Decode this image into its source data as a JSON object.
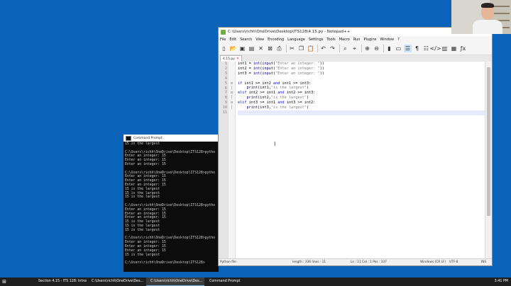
{
  "cmd_window": {
    "title": "Command Prompt",
    "lines": [
      "15 is the largest",
      "",
      "C:\\Users\\richh\\OneDrive\\Desktop\\ITS128>pytho",
      "Enter an integer: 15",
      "Enter an integer: 15",
      "Enter an integer: 15",
      "",
      "C:\\Users\\richh\\OneDrive\\Desktop\\ITS128>pytho",
      "Enter an integer: 15",
      "Enter an integer: 15",
      "Enter an integer: 15",
      "15 is the largest",
      "15 is the largest",
      "15 is the largest",
      "",
      "C:\\Users\\richh\\OneDrive\\Desktop\\ITS128>pytho",
      "Enter an integer: 15",
      "Enter an integer: 15",
      "Enter an integer: 15",
      "15 is the largest",
      "15 is the largest",
      "15 is the largest",
      "",
      "C:\\Users\\richh\\OneDrive\\Desktop\\ITS128>pytho",
      "Enter an integer: 15",
      "Enter an integer: 15",
      "Enter an integer: 15",
      "15 is the largest",
      "",
      "C:\\Users\\richh\\OneDrive\\Desktop\\ITS128>"
    ]
  },
  "notepad": {
    "title": "C:\\Users\\richh\\OneDrive\\Desktop\\ITS128\\4.15.py - Notepad++",
    "menu": [
      "File",
      "Edit",
      "Search",
      "View",
      "Encoding",
      "Language",
      "Settings",
      "Tools",
      "Macro",
      "Run",
      "Plugins",
      "Window",
      "?"
    ],
    "tab_label": "4.15.py",
    "line_numbers": [
      "1",
      "2",
      "3",
      "4",
      "5",
      "6",
      "7",
      "8",
      "9",
      "10",
      "11"
    ],
    "code_lines": [
      "int1 = int(input(\"Enter an integer: \"))",
      "int2 = int(input(\"Enter an integer: \"))",
      "int3 = int(input(\"Enter an integer: \"))",
      "",
      "if int1 >= int2 and int1 >= int3:",
      "    print(int1,\"is the largest\")",
      "elif int2 >= int1 and int2 >= int3:",
      "    print(int2,\"is the largest\")",
      "elif int3 >= int1 and int3 >= int2:",
      "    print(int3,\"is the largest\")",
      ""
    ],
    "status": {
      "file_type": "Python file",
      "length": "length : 336    lines : 11",
      "position": "Ln : 11    Col : 1    Pos : 337",
      "eol": "Windows (CR LF)",
      "encoding": "UTF-8",
      "mode": "INS"
    }
  },
  "taskbar": {
    "tasks": [
      {
        "label": "Section 4.15 - ITS 128: Introd...",
        "color": "#e8592a"
      },
      {
        "label": "C:\\Users\\richh\\OneDrive\\Des...",
        "color": "#f0c419"
      },
      {
        "label": "C:\\Users\\richh\\OneDrive\\Des...",
        "color": "#6cb33e"
      },
      {
        "label": "Command Prompt",
        "color": "#444444"
      }
    ],
    "clock": "3:41 PM"
  }
}
